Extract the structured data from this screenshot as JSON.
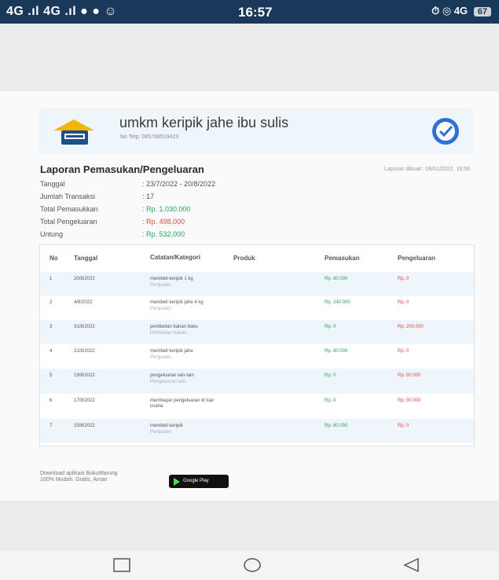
{
  "status_bar": {
    "left": "4G .ıl  4G .ıl  ● ● ☺",
    "time": "16:57",
    "right": "⏱ ◎ 4G",
    "battery": "67"
  },
  "header": {
    "business_name": "umkm keripik jahe ibu sulis",
    "phone": "No Telp: 085768519423",
    "logo_icon": "shop-logo-icon",
    "badge_icon": "verified-check-icon"
  },
  "report": {
    "title": "Laporan Pemasukan/Pengeluaran",
    "generated": "Laporan dibuat : 08/01/2022, 16:56"
  },
  "summary": [
    {
      "label": "Tanggal",
      "value": ": 23/7/2022 - 20/8/2022",
      "color": "#555555"
    },
    {
      "label": "Jumlah Transaksi",
      "value": ": 17",
      "color": "#555555"
    },
    {
      "label": "Total Pemasukkan",
      "value": ": Rp. 1.030.000",
      "color": "#27a45c"
    },
    {
      "label": "Total Pengeluaran",
      "value": ": Rp. 498.000",
      "color": "#e04848"
    },
    {
      "label": "Untung",
      "value": ": Rp. 532.000",
      "color": "#27a45c"
    }
  ],
  "table": {
    "headers": [
      "No",
      "Tanggal",
      "Catatan/Kategori",
      "Produk",
      "Pemasukan",
      "Pengeluaran"
    ],
    "rows": [
      {
        "no": "1",
        "date": "20/8/2022",
        "note": "membeli keripik 1 kg",
        "category": "Penjualan",
        "product": "",
        "income": "Rp. 80.000",
        "expense": "Rp. 0"
      },
      {
        "no": "2",
        "date": "4/8/2022",
        "note": "membeli keripik jahe 4 kg",
        "category": "Penjualan",
        "product": "",
        "income": "Rp. 240.000",
        "expense": "Rp. 0"
      },
      {
        "no": "3",
        "date": "31/8/2022",
        "note": "pembelian bahan baku",
        "category": "Pembelian bahan",
        "product": "",
        "income": "Rp. 0",
        "expense": "Rp. 200.000"
      },
      {
        "no": "4",
        "date": "21/8/2022",
        "note": "membeli keripik jahe",
        "category": "Penjualan",
        "product": "",
        "income": "Rp. 80.000",
        "expense": "Rp. 0"
      },
      {
        "no": "5",
        "date": "19/8/2022",
        "note": "pengeluaran lain-lain",
        "category": "Pengeluaran lain-",
        "product": "",
        "income": "Rp. 0",
        "expense": "Rp. 80.000"
      },
      {
        "no": "6",
        "date": "17/8/2022",
        "note": "membayar pengeluaran di luar usaha",
        "category": "",
        "product": "",
        "income": "Rp. 0",
        "expense": "Rp. 90.000"
      },
      {
        "no": "7",
        "date": "15/8/2022",
        "note": "membeli keripik",
        "category": "Penjualan",
        "product": "",
        "income": "Rp. 80.000",
        "expense": "Rp. 0"
      }
    ]
  },
  "footer": {
    "download_line1": "Download aplikasi BukuWarung",
    "download_line2": "100% Mudah, Gratis, Aman",
    "play_store_label": "Google Play"
  },
  "colors": {
    "income": "#27a45c",
    "expense": "#e04848",
    "status_bar": "#19385a",
    "header_bg": "#eef5fb"
  },
  "nav": {
    "recent_icon": "square-recents-icon",
    "home_icon": "circle-home-icon",
    "back_icon": "triangle-back-icon"
  }
}
